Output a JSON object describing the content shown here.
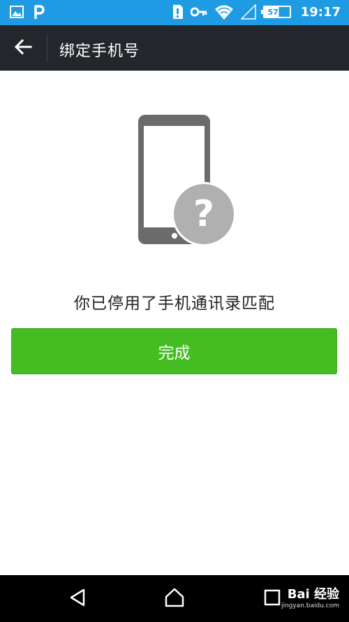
{
  "status_bar": {
    "battery_percent": "57%",
    "battery_level": 0.57,
    "time": "19:17",
    "icons": [
      "gallery-icon",
      "parking-app-icon",
      "sim-icon",
      "key-icon",
      "wifi-icon",
      "signal-icon",
      "battery-icon"
    ]
  },
  "app_bar": {
    "title": "绑定手机号",
    "back_icon": "arrow-left-icon"
  },
  "content": {
    "illustration_icon": "phone-question-icon",
    "message": "你已停用了手机通讯录匹配",
    "done_button_label": "完成"
  },
  "nav_bar": {
    "icons": [
      "back-triangle-icon",
      "home-icon",
      "recents-icon"
    ]
  },
  "watermark": {
    "main": "Bai 经验",
    "sub": "jingyan.baidu.com"
  },
  "colors": {
    "status_bar": "#1f9be3",
    "app_bar": "#23272b",
    "accent_green": "#44bd23",
    "nav_bar": "#000000"
  }
}
